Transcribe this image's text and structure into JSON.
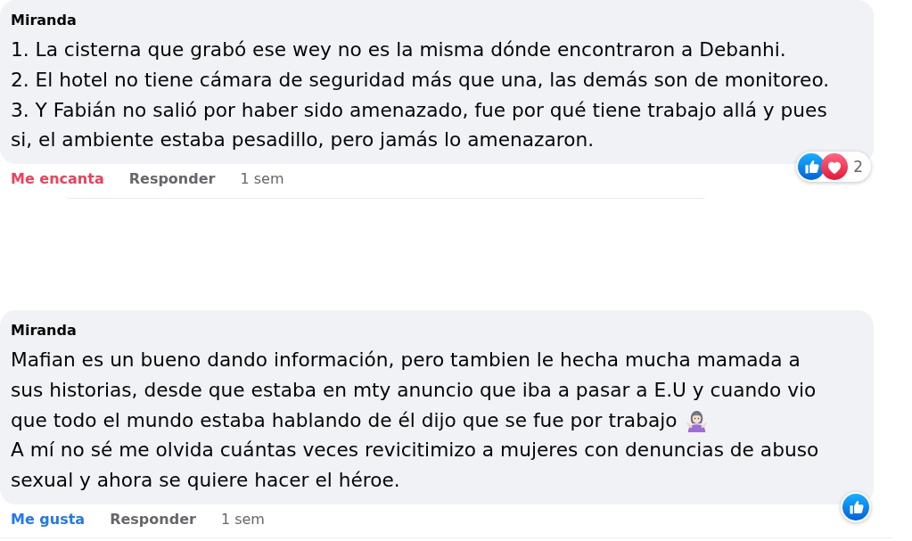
{
  "comments": [
    {
      "author": "Miranda",
      "paragraphs": [
        {
          "kind": "plain",
          "text": "1. La cisterna que grabó ese wey no es la misma dónde encontraron a Debanhi."
        },
        {
          "kind": "plain",
          "text": "2. El hotel no tiene cámara de seguridad más que una, las demás son de monitoreo."
        },
        {
          "kind": "plain",
          "text": "3. Y Fabián no salió por haber sido amenazado, fue por qué tiene trabajo allá y pues si, el ambiente estaba pesadillo, pero jamás lo amenazaron."
        }
      ],
      "reactions": {
        "icons": [
          {
            "kind": "like"
          },
          {
            "kind": "love"
          }
        ],
        "count": "2"
      },
      "actions": [
        {
          "kind": "love",
          "label": "Me encanta",
          "active": true
        },
        {
          "kind": "reply",
          "label": "Responder"
        }
      ],
      "time": "1 sem"
    },
    {
      "author": "Miranda",
      "paragraphs": [
        {
          "kind": "plain",
          "text": "Mafian es un bueno dando información, pero tambien le hecha mucha mamada a sus historias, desde que estaba en mty anuncio que iba a pasar a E.U y cuando vio"
        },
        {
          "kind": "emoji",
          "text": "que todo el mundo estaba hablando de él dijo que se fue por trabajo"
        },
        {
          "kind": "plain",
          "text": "A mí no sé me olvida cuántas veces revicitimizo a mujeres con denuncias de abuso sexual y ahora se quiere hacer el héroe."
        }
      ],
      "reactions": {
        "icons": [
          {
            "kind": "like"
          }
        ]
      },
      "actions": [
        {
          "kind": "like",
          "label": "Me gusta",
          "active": true
        },
        {
          "kind": "reply",
          "label": "Responder"
        }
      ],
      "time": "1 sem"
    }
  ]
}
